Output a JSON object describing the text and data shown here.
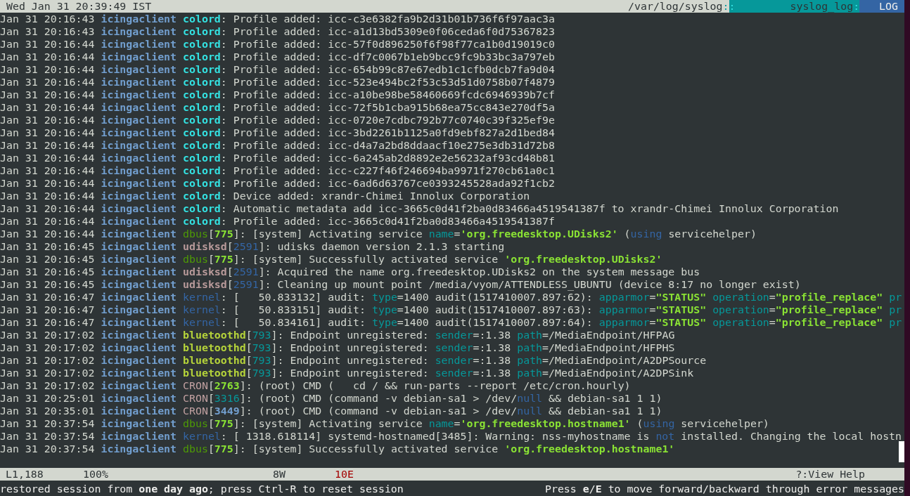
{
  "top_bar": {
    "clock": "Wed Jan 31 20:39:49 IST",
    "segments": [
      {
        "kind": "path",
        "text": "/var/log/syslog"
      },
      {
        "kind": "path-sep",
        "text": ":"
      },
      {
        "kind": "format-sep",
        "text": ":"
      },
      {
        "kind": "format",
        "text": "syslog_log"
      },
      {
        "kind": "format-sep",
        "text": ":"
      },
      {
        "kind": "mode",
        "text": "LOG"
      }
    ]
  },
  "log_lines": [
    {
      "time": "Jan 31 20:16:43",
      "host": "icingaclient",
      "parts": [
        {
          "kind": "tag-bold",
          "color": "#34e2e2",
          "text": "colord"
        },
        {
          "kind": "plain",
          "text": ": Profile added: icc-c3e6382fa9b2d31b01b736f6f97aac3a"
        }
      ]
    },
    {
      "time": "Jan 31 20:16:43",
      "host": "icingaclient",
      "parts": [
        {
          "kind": "tag-bold",
          "color": "#34e2e2",
          "text": "colord"
        },
        {
          "kind": "plain",
          "text": ": Profile added: icc-a1d13bd5309e0f06ceda6f0d75367823"
        }
      ]
    },
    {
      "time": "Jan 31 20:16:44",
      "host": "icingaclient",
      "parts": [
        {
          "kind": "tag-bold",
          "color": "#34e2e2",
          "text": "colord"
        },
        {
          "kind": "plain",
          "text": ": Profile added: icc-57f0d896250f6f98f77ca1b0d19019c0"
        }
      ]
    },
    {
      "time": "Jan 31 20:16:44",
      "host": "icingaclient",
      "parts": [
        {
          "kind": "tag-bold",
          "color": "#34e2e2",
          "text": "colord"
        },
        {
          "kind": "plain",
          "text": ": Profile added: icc-df7c0067b1eb9bcc9fc9b33bc3a797eb"
        }
      ]
    },
    {
      "time": "Jan 31 20:16:44",
      "host": "icingaclient",
      "parts": [
        {
          "kind": "tag-bold",
          "color": "#34e2e2",
          "text": "colord"
        },
        {
          "kind": "plain",
          "text": ": Profile added: icc-654b99c87e67edb1c1cfb0dcb7fa9d04"
        }
      ]
    },
    {
      "time": "Jan 31 20:16:44",
      "host": "icingaclient",
      "parts": [
        {
          "kind": "tag-bold",
          "color": "#34e2e2",
          "text": "colord"
        },
        {
          "kind": "plain",
          "text": ": Profile added: icc-523e494bc2f53c53d51d0758b07f4879"
        }
      ]
    },
    {
      "time": "Jan 31 20:16:44",
      "host": "icingaclient",
      "parts": [
        {
          "kind": "tag-bold",
          "color": "#34e2e2",
          "text": "colord"
        },
        {
          "kind": "plain",
          "text": ": Profile added: icc-a10be98be58460669fcdc6946939b7cf"
        }
      ]
    },
    {
      "time": "Jan 31 20:16:44",
      "host": "icingaclient",
      "parts": [
        {
          "kind": "tag-bold",
          "color": "#34e2e2",
          "text": "colord"
        },
        {
          "kind": "plain",
          "text": ": Profile added: icc-72f5b1cba915b68ea75cc843e270df5a"
        }
      ]
    },
    {
      "time": "Jan 31 20:16:44",
      "host": "icingaclient",
      "parts": [
        {
          "kind": "tag-bold",
          "color": "#34e2e2",
          "text": "colord"
        },
        {
          "kind": "plain",
          "text": ": Profile added: icc-0720e7cdbc792b77c0740c39f325ef9e"
        }
      ]
    },
    {
      "time": "Jan 31 20:16:44",
      "host": "icingaclient",
      "parts": [
        {
          "kind": "tag-bold",
          "color": "#34e2e2",
          "text": "colord"
        },
        {
          "kind": "plain",
          "text": ": Profile added: icc-3bd2261b1125a0fd9ebf827a2d1bed84"
        }
      ]
    },
    {
      "time": "Jan 31 20:16:44",
      "host": "icingaclient",
      "parts": [
        {
          "kind": "tag-bold",
          "color": "#34e2e2",
          "text": "colord"
        },
        {
          "kind": "plain",
          "text": ": Profile added: icc-d4a7a2bd8ddaacf10e275e3db31d72b8"
        }
      ]
    },
    {
      "time": "Jan 31 20:16:44",
      "host": "icingaclient",
      "parts": [
        {
          "kind": "tag-bold",
          "color": "#34e2e2",
          "text": "colord"
        },
        {
          "kind": "plain",
          "text": ": Profile added: icc-6a245ab2d8892e2e56232af93cd48b81"
        }
      ]
    },
    {
      "time": "Jan 31 20:16:44",
      "host": "icingaclient",
      "parts": [
        {
          "kind": "tag-bold",
          "color": "#34e2e2",
          "text": "colord"
        },
        {
          "kind": "plain",
          "text": ": Profile added: icc-c227f46f246694ba9971f270cb61a0c1"
        }
      ]
    },
    {
      "time": "Jan 31 20:16:44",
      "host": "icingaclient",
      "parts": [
        {
          "kind": "tag-bold",
          "color": "#34e2e2",
          "text": "colord"
        },
        {
          "kind": "plain",
          "text": ": Profile added: icc-6ad6d63767ce0393245528ada92f1cb2"
        }
      ]
    },
    {
      "time": "Jan 31 20:16:44",
      "host": "icingaclient",
      "parts": [
        {
          "kind": "tag-bold",
          "color": "#34e2e2",
          "text": "colord"
        },
        {
          "kind": "plain",
          "text": ": Device added: xrandr-Chimei Innolux Corporation"
        }
      ]
    },
    {
      "time": "Jan 31 20:16:44",
      "host": "icingaclient",
      "parts": [
        {
          "kind": "tag-bold",
          "color": "#34e2e2",
          "text": "colord"
        },
        {
          "kind": "plain",
          "text": ": Automatic metadata add icc-3665c0d41f2ba0d83466a4519541387f to xrandr-Chimei Innolux Corporation"
        }
      ]
    },
    {
      "time": "Jan 31 20:16:44",
      "host": "icingaclient",
      "parts": [
        {
          "kind": "tag-bold",
          "color": "#34e2e2",
          "text": "colord"
        },
        {
          "kind": "plain",
          "text": ": Profile added: icc-3665c0d41f2ba0d83466a4519541387f"
        }
      ]
    },
    {
      "time": "Jan 31 20:16:44",
      "host": "icingaclient",
      "parts": [
        {
          "kind": "tag",
          "color": "#4e9a06",
          "text": "dbus"
        },
        {
          "kind": "plain",
          "text": "["
        },
        {
          "kind": "tag-bold",
          "color": "#8ae234",
          "text": "775"
        },
        {
          "kind": "plain",
          "text": "]: [system] Activating service "
        },
        {
          "kind": "key",
          "text": "name"
        },
        {
          "kind": "plain",
          "text": "="
        },
        {
          "kind": "string",
          "text": "'org.freedesktop.UDisks2'"
        },
        {
          "kind": "plain",
          "text": " ("
        },
        {
          "kind": "keyword",
          "text": "using"
        },
        {
          "kind": "plain",
          "text": " servicehelper)"
        }
      ]
    },
    {
      "time": "Jan 31 20:16:45",
      "host": "icingaclient",
      "parts": [
        {
          "kind": "tag-bold",
          "color": "#b89a9a",
          "text": "udisksd"
        },
        {
          "kind": "plain",
          "text": "["
        },
        {
          "kind": "tag",
          "color": "#3465a4",
          "text": "2591"
        },
        {
          "kind": "plain",
          "text": "]: udisks daemon version 2.1.3 starting"
        }
      ]
    },
    {
      "time": "Jan 31 20:16:45",
      "host": "icingaclient",
      "parts": [
        {
          "kind": "tag",
          "color": "#4e9a06",
          "text": "dbus"
        },
        {
          "kind": "plain",
          "text": "["
        },
        {
          "kind": "tag-bold",
          "color": "#8ae234",
          "text": "775"
        },
        {
          "kind": "plain",
          "text": "]: [system] Successfully activated service "
        },
        {
          "kind": "string",
          "text": "'org.freedesktop.UDisks2'"
        }
      ]
    },
    {
      "time": "Jan 31 20:16:45",
      "host": "icingaclient",
      "parts": [
        {
          "kind": "tag-bold",
          "color": "#b89a9a",
          "text": "udisksd"
        },
        {
          "kind": "plain",
          "text": "["
        },
        {
          "kind": "tag",
          "color": "#3465a4",
          "text": "2591"
        },
        {
          "kind": "plain",
          "text": "]: Acquired the name org.freedesktop.UDisks2 on the system message bus"
        }
      ]
    },
    {
      "time": "Jan 31 20:16:45",
      "host": "icingaclient",
      "parts": [
        {
          "kind": "tag-bold",
          "color": "#b89a9a",
          "text": "udisksd"
        },
        {
          "kind": "plain",
          "text": "["
        },
        {
          "kind": "tag",
          "color": "#3465a4",
          "text": "2591"
        },
        {
          "kind": "plain",
          "text": "]: Cleaning up mount point /media/vyom/ATTENDLESS_UBUNTU (device 8:17 no longer exist)"
        }
      ]
    },
    {
      "time": "Jan 31 20:16:47",
      "host": "icingaclient",
      "parts": [
        {
          "kind": "tag",
          "color": "#3465a4",
          "text": "kernel"
        },
        {
          "kind": "plain",
          "text": ": [   50.833132] audit: "
        },
        {
          "kind": "key",
          "text": "type"
        },
        {
          "kind": "plain",
          "text": "=1400 audit(1517410007.897:62): "
        },
        {
          "kind": "key",
          "text": "apparmor"
        },
        {
          "kind": "plain",
          "text": "="
        },
        {
          "kind": "string",
          "text": "\"STATUS\""
        },
        {
          "kind": "key",
          "text": " operation"
        },
        {
          "kind": "plain",
          "text": "="
        },
        {
          "kind": "string",
          "text": "\"profile_replace\""
        },
        {
          "kind": "key",
          "text": " pr"
        }
      ]
    },
    {
      "time": "Jan 31 20:16:47",
      "host": "icingaclient",
      "parts": [
        {
          "kind": "tag",
          "color": "#3465a4",
          "text": "kernel"
        },
        {
          "kind": "plain",
          "text": ": [   50.833151] audit: "
        },
        {
          "kind": "key",
          "text": "type"
        },
        {
          "kind": "plain",
          "text": "=1400 audit(1517410007.897:63): "
        },
        {
          "kind": "key",
          "text": "apparmor"
        },
        {
          "kind": "plain",
          "text": "="
        },
        {
          "kind": "string",
          "text": "\"STATUS\""
        },
        {
          "kind": "key",
          "text": " operation"
        },
        {
          "kind": "plain",
          "text": "="
        },
        {
          "kind": "string",
          "text": "\"profile_replace\""
        },
        {
          "kind": "key",
          "text": " pr"
        }
      ]
    },
    {
      "time": "Jan 31 20:16:47",
      "host": "icingaclient",
      "parts": [
        {
          "kind": "tag",
          "color": "#3465a4",
          "text": "kernel"
        },
        {
          "kind": "plain",
          "text": ": [   50.834161] audit: "
        },
        {
          "kind": "key",
          "text": "type"
        },
        {
          "kind": "plain",
          "text": "=1400 audit(1517410007.897:64): "
        },
        {
          "kind": "key",
          "text": "apparmor"
        },
        {
          "kind": "plain",
          "text": "="
        },
        {
          "kind": "string",
          "text": "\"STATUS\""
        },
        {
          "kind": "key",
          "text": " operation"
        },
        {
          "kind": "plain",
          "text": "="
        },
        {
          "kind": "string",
          "text": "\"profile_replace\""
        },
        {
          "kind": "key",
          "text": " pr"
        }
      ]
    },
    {
      "time": "Jan 31 20:17:02",
      "host": "icingaclient",
      "parts": [
        {
          "kind": "tag-bold",
          "color": "#b5d33a",
          "text": "bluetoothd"
        },
        {
          "kind": "plain",
          "text": "["
        },
        {
          "kind": "tag",
          "color": "#06989a",
          "text": "793"
        },
        {
          "kind": "plain",
          "text": "]: Endpoint unregistered: "
        },
        {
          "kind": "key",
          "text": "sender"
        },
        {
          "kind": "plain",
          "text": "=:1.38 "
        },
        {
          "kind": "key",
          "text": "path"
        },
        {
          "kind": "plain",
          "text": "=/MediaEndpoint/HFPAG"
        }
      ]
    },
    {
      "time": "Jan 31 20:17:02",
      "host": "icingaclient",
      "parts": [
        {
          "kind": "tag-bold",
          "color": "#b5d33a",
          "text": "bluetoothd"
        },
        {
          "kind": "plain",
          "text": "["
        },
        {
          "kind": "tag",
          "color": "#06989a",
          "text": "793"
        },
        {
          "kind": "plain",
          "text": "]: Endpoint unregistered: "
        },
        {
          "kind": "key",
          "text": "sender"
        },
        {
          "kind": "plain",
          "text": "=:1.38 "
        },
        {
          "kind": "key",
          "text": "path"
        },
        {
          "kind": "plain",
          "text": "=/MediaEndpoint/HFPHS"
        }
      ]
    },
    {
      "time": "Jan 31 20:17:02",
      "host": "icingaclient",
      "parts": [
        {
          "kind": "tag-bold",
          "color": "#b5d33a",
          "text": "bluetoothd"
        },
        {
          "kind": "plain",
          "text": "["
        },
        {
          "kind": "tag",
          "color": "#06989a",
          "text": "793"
        },
        {
          "kind": "plain",
          "text": "]: Endpoint unregistered: "
        },
        {
          "kind": "key",
          "text": "sender"
        },
        {
          "kind": "plain",
          "text": "=:1.38 "
        },
        {
          "kind": "key",
          "text": "path"
        },
        {
          "kind": "plain",
          "text": "=/MediaEndpoint/A2DPSource"
        }
      ]
    },
    {
      "time": "Jan 31 20:17:02",
      "host": "icingaclient",
      "parts": [
        {
          "kind": "tag-bold",
          "color": "#b5d33a",
          "text": "bluetoothd"
        },
        {
          "kind": "plain",
          "text": "["
        },
        {
          "kind": "tag",
          "color": "#06989a",
          "text": "793"
        },
        {
          "kind": "plain",
          "text": "]: Endpoint unregistered: "
        },
        {
          "kind": "key",
          "text": "sender"
        },
        {
          "kind": "plain",
          "text": "=:1.38 "
        },
        {
          "kind": "key",
          "text": "path"
        },
        {
          "kind": "plain",
          "text": "=/MediaEndpoint/A2DPSink"
        }
      ]
    },
    {
      "time": "Jan 31 20:17:02",
      "host": "icingaclient",
      "parts": [
        {
          "kind": "tag",
          "color": "#c0a0a0",
          "text": "CRON"
        },
        {
          "kind": "plain",
          "text": "["
        },
        {
          "kind": "tag-bold",
          "color": "#8ae234",
          "text": "2763"
        },
        {
          "kind": "plain",
          "text": "]: (root) CMD (   cd / && run-parts --report /etc/cron.hourly)"
        }
      ]
    },
    {
      "time": "Jan 31 20:25:01",
      "host": "icingaclient",
      "parts": [
        {
          "kind": "tag",
          "color": "#c0a0a0",
          "text": "CRON"
        },
        {
          "kind": "plain",
          "text": "["
        },
        {
          "kind": "tag",
          "color": "#06989a",
          "text": "3316"
        },
        {
          "kind": "plain",
          "text": "]: (root) CMD (command -v debian-sa1 > /dev/"
        },
        {
          "kind": "keyword",
          "text": "null"
        },
        {
          "kind": "plain",
          "text": " && debian-sa1 1 1)"
        }
      ]
    },
    {
      "time": "Jan 31 20:35:01",
      "host": "icingaclient",
      "parts": [
        {
          "kind": "tag",
          "color": "#c0a0a0",
          "text": "CRON"
        },
        {
          "kind": "plain",
          "text": "["
        },
        {
          "kind": "tag-bold",
          "color": "#729fcf",
          "text": "3449"
        },
        {
          "kind": "plain",
          "text": "]: (root) CMD (command -v debian-sa1 > /dev/"
        },
        {
          "kind": "keyword",
          "text": "null"
        },
        {
          "kind": "plain",
          "text": " && debian-sa1 1 1)"
        }
      ]
    },
    {
      "time": "Jan 31 20:37:54",
      "host": "icingaclient",
      "parts": [
        {
          "kind": "tag",
          "color": "#4e9a06",
          "text": "dbus"
        },
        {
          "kind": "plain",
          "text": "["
        },
        {
          "kind": "tag-bold",
          "color": "#8ae234",
          "text": "775"
        },
        {
          "kind": "plain",
          "text": "]: [system] Activating service "
        },
        {
          "kind": "key",
          "text": "name"
        },
        {
          "kind": "plain",
          "text": "="
        },
        {
          "kind": "string",
          "text": "'org.freedesktop.hostname1'"
        },
        {
          "kind": "plain",
          "text": " ("
        },
        {
          "kind": "keyword",
          "text": "using"
        },
        {
          "kind": "plain",
          "text": " servicehelper)"
        }
      ]
    },
    {
      "time": "Jan 31 20:37:54",
      "host": "icingaclient",
      "parts": [
        {
          "kind": "tag",
          "color": "#3465a4",
          "text": "kernel"
        },
        {
          "kind": "plain",
          "text": ": [ 1318.618114] systemd-hostnamed[3485]: Warning: nss-myhostname is "
        },
        {
          "kind": "keyword",
          "text": "not"
        },
        {
          "kind": "plain",
          "text": " installed. Changing the local hostn"
        }
      ]
    },
    {
      "time": "Jan 31 20:37:54",
      "host": "icingaclient",
      "parts": [
        {
          "kind": "tag",
          "color": "#4e9a06",
          "text": "dbus"
        },
        {
          "kind": "plain",
          "text": "["
        },
        {
          "kind": "tag-bold",
          "color": "#8ae234",
          "text": "775"
        },
        {
          "kind": "plain",
          "text": "]: [system] Successfully activated service "
        },
        {
          "kind": "string",
          "text": "'org.freedesktop.hostname1'"
        }
      ]
    }
  ],
  "status_bar": {
    "position": "L1,188",
    "percent": "100%",
    "warnings": "8W",
    "errors": "10E",
    "help": "?:View Help"
  },
  "message_line": {
    "left": "restored session from **one day ago**; press Ctrl-R to reset session",
    "right": "Press **e**/**E** to move forward/backward through error messages"
  }
}
